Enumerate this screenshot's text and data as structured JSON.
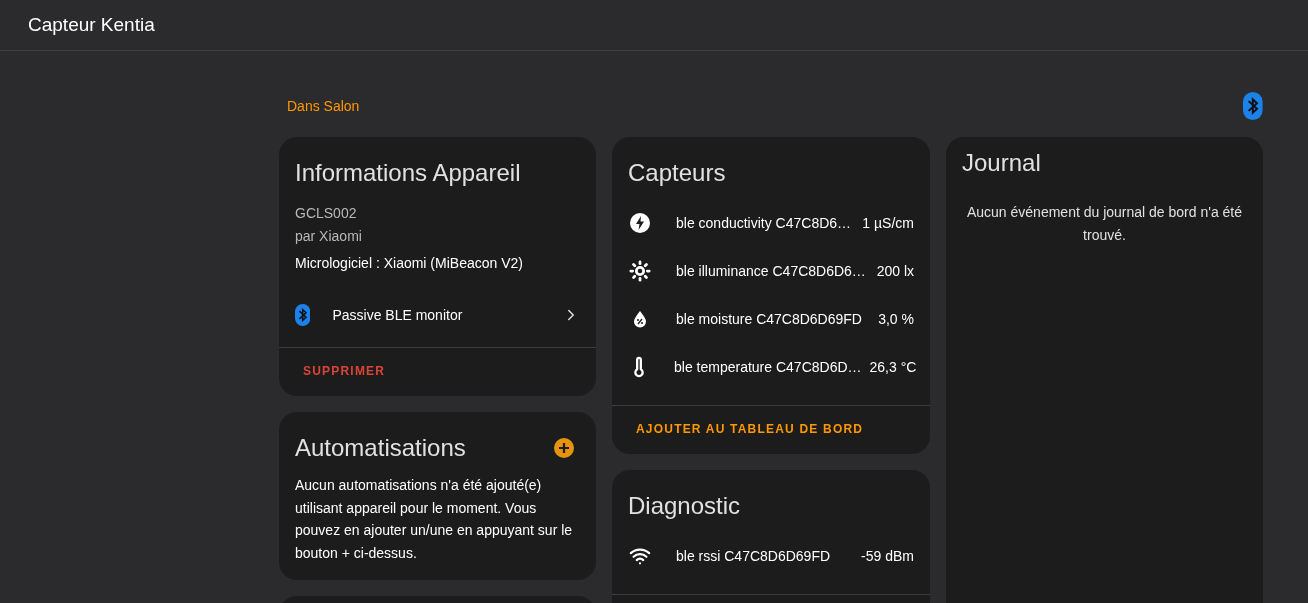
{
  "header": {
    "title": "Capteur Kentia"
  },
  "area": "Dans Salon",
  "device_info": {
    "title": "Informations Appareil",
    "model": "GCLS002",
    "manufacturer": "par Xiaomi",
    "firmware": "Micrologiciel : Xiaomi (MiBeacon V2)",
    "integration": {
      "label": "Passive BLE monitor"
    },
    "action": "SUPPRIMER"
  },
  "automations": {
    "title": "Automatisations",
    "text": "Aucun automatisations n'a été ajouté(e) utilisant appareil pour le moment. Vous pouvez en ajouter un/une en appuyant sur le bouton + ci-dessus."
  },
  "sensors": {
    "title": "Capteurs",
    "items": [
      {
        "kind": "conductivity",
        "name": "ble conductivity C47C8D6…",
        "value": "1 µS/cm"
      },
      {
        "kind": "illuminance",
        "name": "ble illuminance C47C8D6D6…",
        "value": "200 lx"
      },
      {
        "kind": "moisture",
        "name": "ble moisture C47C8D6D69FD",
        "value": "3,0 %"
      },
      {
        "kind": "temperature",
        "name": "ble temperature C47C8D6D…",
        "value": "26,3 °C"
      }
    ],
    "action": "AJOUTER AU TABLEAU DE BORD"
  },
  "diagnostic": {
    "title": "Diagnostic",
    "items": [
      {
        "kind": "signal",
        "name": "ble rssi C47C8D6D69FD",
        "value": "-59 dBm"
      }
    ]
  },
  "journal": {
    "title": "Journal",
    "empty_text": "Aucun événement du journal de bord n'a été trouvé."
  }
}
